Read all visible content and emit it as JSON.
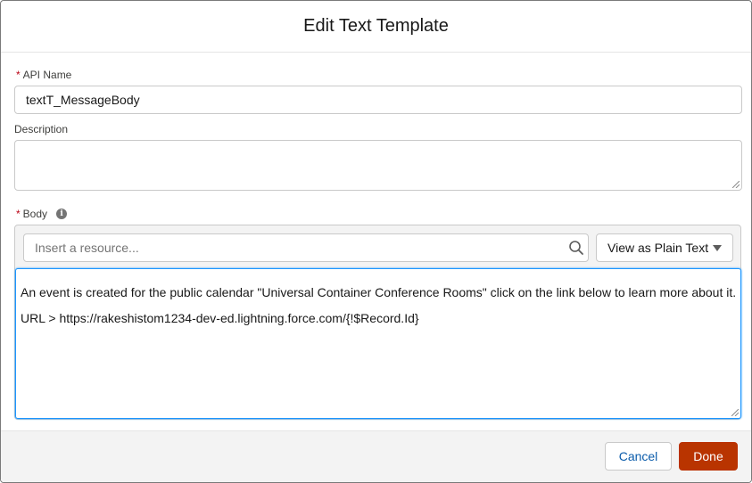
{
  "modal": {
    "title": "Edit Text Template"
  },
  "form": {
    "api_name": {
      "label": "API Name",
      "required_mark": "*",
      "value": "textT_MessageBody"
    },
    "description": {
      "label": "Description",
      "value": ""
    },
    "body": {
      "label": "Body",
      "required_mark": "*",
      "info_icon": "info-icon",
      "resource_placeholder": "Insert a resource...",
      "view_mode": "View as Plain Text",
      "lines": [
        "An event is created for the public calendar \"Universal Container Conference Rooms\" click on the link below to learn more about it.",
        "URL > https://rakeshistom1234-dev-ed.lightning.force.com/{!$Record.Id}"
      ]
    }
  },
  "footer": {
    "cancel_label": "Cancel",
    "done_label": "Done"
  },
  "colors": {
    "required": "#ba0517",
    "done_button": "#b93400",
    "focus_border": "#1b96ff",
    "cancel_text": "#0b5cab"
  }
}
